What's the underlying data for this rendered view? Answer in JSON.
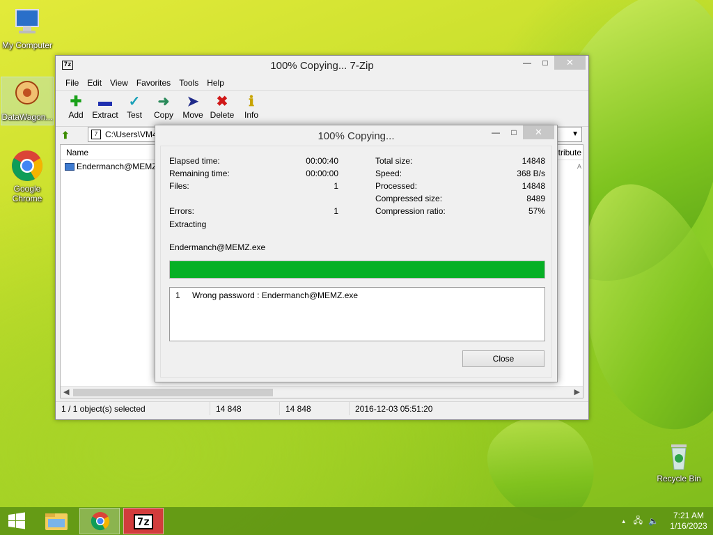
{
  "desktop": {
    "icons": [
      {
        "label": "My Computer"
      },
      {
        "label": "DataWagon..."
      },
      {
        "label": "Google Chrome"
      },
      {
        "label": "Recycle Bin"
      }
    ]
  },
  "main_window": {
    "title": "100% Copying... 7-Zip",
    "app_icon": "7z",
    "menu": [
      "File",
      "Edit",
      "View",
      "Favorites",
      "Tools",
      "Help"
    ],
    "toolbar": [
      {
        "label": "Add",
        "icon": "plus-icon",
        "color": "#1aa11a"
      },
      {
        "label": "Extract",
        "icon": "minus-icon",
        "color": "#1f2fb0"
      },
      {
        "label": "Test",
        "icon": "check-icon",
        "color": "#19a0b8"
      },
      {
        "label": "Copy",
        "icon": "double-arrow-icon",
        "color": "#2a8a5a"
      },
      {
        "label": "Move",
        "icon": "arrow-right-icon",
        "color": "#1f2a8a"
      },
      {
        "label": "Delete",
        "icon": "x-icon",
        "color": "#d01818"
      },
      {
        "label": "Info",
        "icon": "info-icon",
        "color": "#c8a400"
      }
    ],
    "address": "C:\\Users\\VM4\\",
    "columns": {
      "name": "Name",
      "attributes": "tribute"
    },
    "files": [
      {
        "name": "Endermanch@MEMZ",
        "attr": "A"
      }
    ],
    "status": {
      "selected": "1 / 1 object(s) selected",
      "size": "14 848",
      "packed": "14 848",
      "modified": "2016-12-03 05:51:20"
    }
  },
  "progress_dialog": {
    "title": "100% Copying...",
    "left_stats": [
      {
        "label": "Elapsed time:",
        "value": "00:00:40"
      },
      {
        "label": "Remaining time:",
        "value": "00:00:00"
      },
      {
        "label": "Files:",
        "value": "1"
      },
      {
        "label": "Errors:",
        "value": "1"
      }
    ],
    "right_stats": [
      {
        "label": "Total size:",
        "value": "14848"
      },
      {
        "label": "Speed:",
        "value": "368 B/s"
      },
      {
        "label": "Processed:",
        "value": "14848"
      },
      {
        "label": "Compressed size:",
        "value": "8489"
      },
      {
        "label": "Compression ratio:",
        "value": "57%"
      }
    ],
    "operation": "Extracting",
    "current_file": "Endermanch@MEMZ.exe",
    "progress": 1.0,
    "progress_color": "#06b025",
    "messages": [
      {
        "num": "1",
        "text": "Wrong password : Endermanch@MEMZ.exe"
      }
    ],
    "close_label": "Close"
  },
  "taskbar": {
    "clock_time": "7:21 AM",
    "clock_date": "1/16/2023",
    "tray_arrow": "▲"
  }
}
